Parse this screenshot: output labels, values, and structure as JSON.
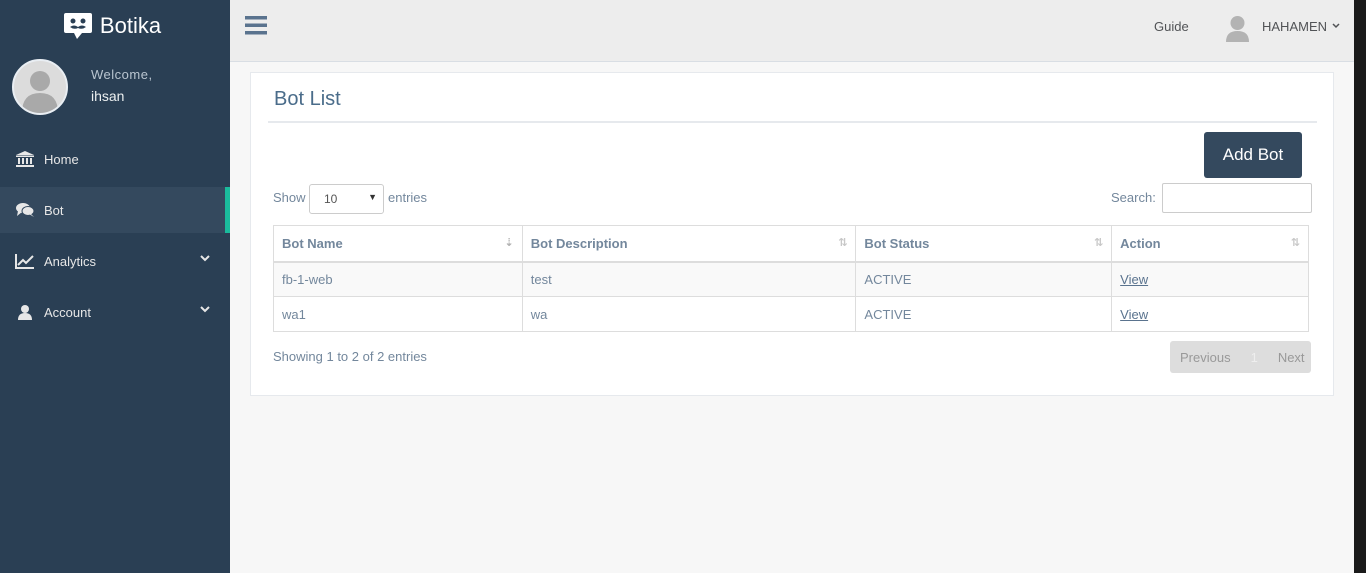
{
  "brand": {
    "name": "Botika"
  },
  "profile": {
    "welcome": "Welcome,",
    "username": "ihsan"
  },
  "menu": [
    {
      "label": "Home",
      "icon": "bank-icon",
      "active": false,
      "has_submenu": false
    },
    {
      "label": "Bot",
      "icon": "comments-icon",
      "active": true,
      "has_submenu": false
    },
    {
      "label": "Analytics",
      "icon": "line-chart-icon",
      "active": false,
      "has_submenu": true
    },
    {
      "label": "Account",
      "icon": "user-icon",
      "active": false,
      "has_submenu": true
    }
  ],
  "topnav": {
    "guide": "Guide",
    "user": "HAHAMEN"
  },
  "panel": {
    "title": "Bot List",
    "add_button": "Add Bot",
    "show_label": "Show",
    "entries_label": "entries",
    "page_length": "10",
    "search_label": "Search:",
    "search_value": ""
  },
  "table": {
    "columns": [
      "Bot Name",
      "Bot Description",
      "Bot Status",
      "Action"
    ],
    "rows": [
      {
        "name": "fb-1-web",
        "description": "test",
        "status": "ACTIVE",
        "action": "View"
      },
      {
        "name": "wa1",
        "description": "wa",
        "status": "ACTIVE",
        "action": "View"
      }
    ]
  },
  "footer": {
    "info": "Showing 1 to 2 of 2 entries",
    "prev": "Previous",
    "page": "1",
    "next": "Next"
  },
  "colors": {
    "sidebar": "#2a3f54",
    "active_item": "#34495e",
    "accent": "#1abb9c",
    "button": "#34495e"
  }
}
